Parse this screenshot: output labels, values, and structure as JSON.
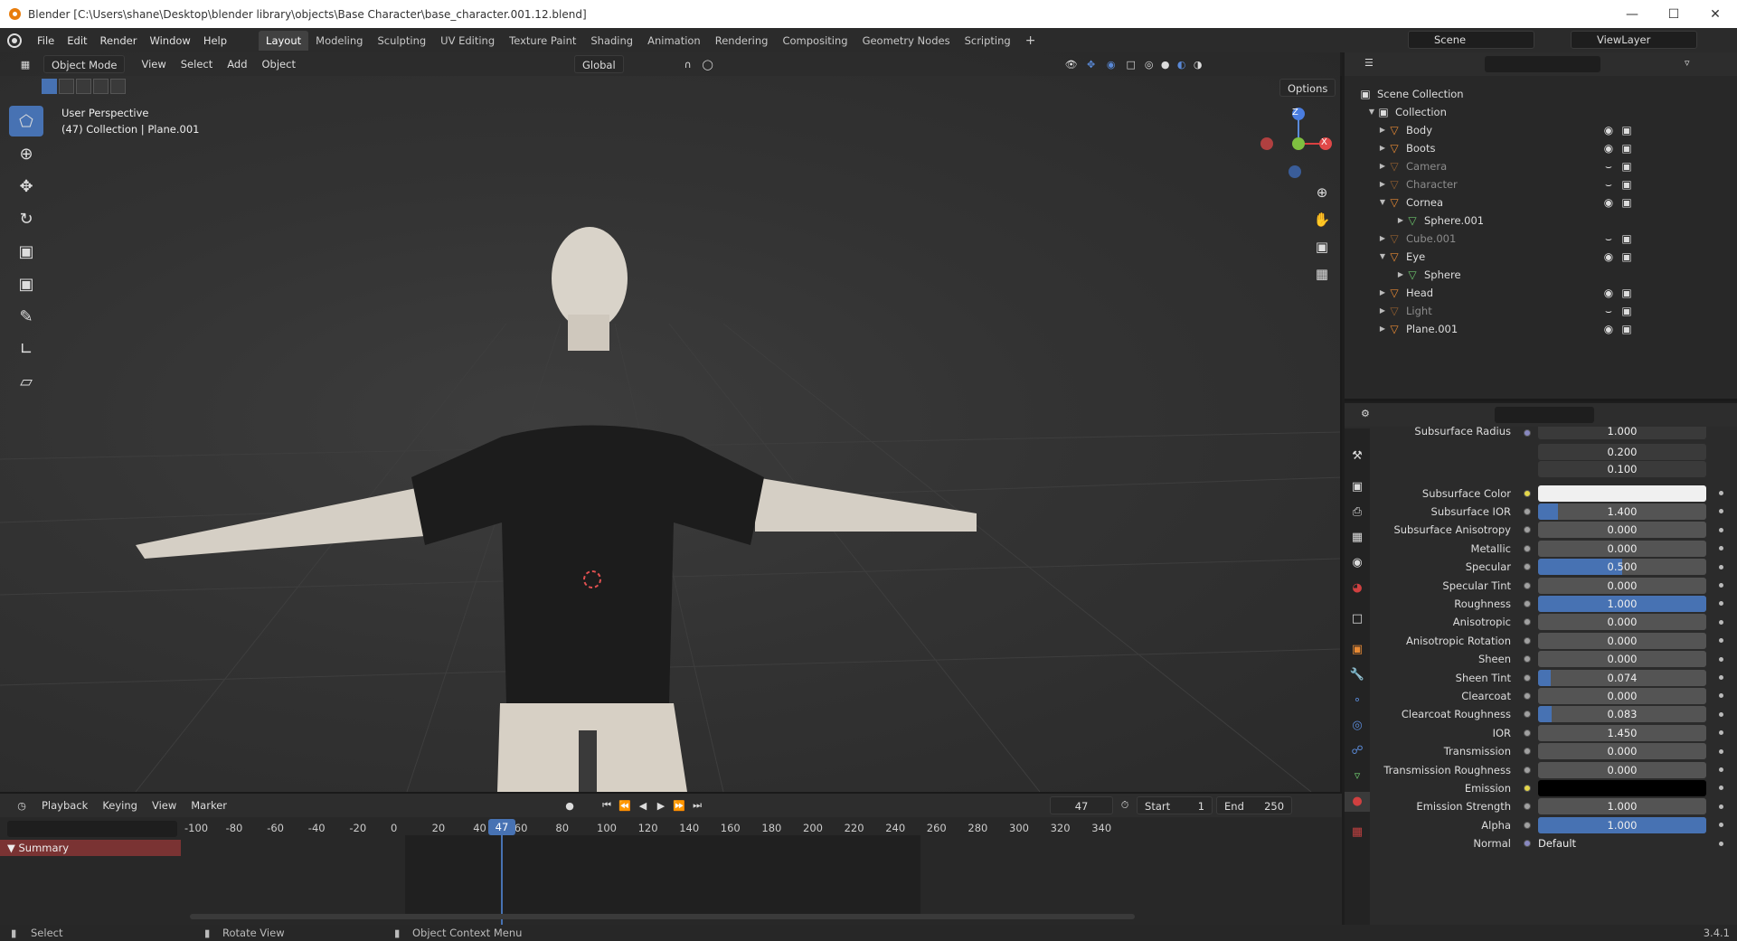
{
  "window": {
    "title": "Blender [C:\\Users\\shane\\Desktop\\blender library\\objects\\Base Character\\base_character.001.12.blend]"
  },
  "menu": [
    "File",
    "Edit",
    "Render",
    "Window",
    "Help"
  ],
  "workspaces": [
    "Layout",
    "Modeling",
    "Sculpting",
    "UV Editing",
    "Texture Paint",
    "Shading",
    "Animation",
    "Rendering",
    "Compositing",
    "Geometry Nodes",
    "Scripting"
  ],
  "active_workspace": "Layout",
  "scene": {
    "name": "Scene",
    "view_layer": "ViewLayer"
  },
  "viewport": {
    "mode": "Object Mode",
    "menus": [
      "View",
      "Select",
      "Add",
      "Object"
    ],
    "orientation": "Global",
    "options_label": "Options",
    "overlay_line1": "User Perspective",
    "overlay_line2": "(47) Collection | Plane.001",
    "gizmo": {
      "z": "Z",
      "x": "X"
    }
  },
  "timeline": {
    "menus": [
      "Playback",
      "Keying",
      "View",
      "Marker"
    ],
    "current_frame": "47",
    "start_label": "Start",
    "start": "1",
    "end_label": "End",
    "end": "250",
    "ruler": [
      "-100",
      "-80",
      "-60",
      "-40",
      "-20",
      "0",
      "20",
      "40",
      "60",
      "80",
      "100",
      "120",
      "140",
      "160",
      "180",
      "200",
      "220",
      "240",
      "260",
      "280",
      "300",
      "320",
      "340"
    ],
    "summary": "Summary"
  },
  "outliner": {
    "root": "Scene Collection",
    "collection": "Collection",
    "items": [
      {
        "name": "Body",
        "dim": false,
        "expanded": false,
        "depth": 0
      },
      {
        "name": "Boots",
        "dim": false,
        "expanded": false,
        "depth": 0
      },
      {
        "name": "Camera",
        "dim": true,
        "expanded": false,
        "depth": 0
      },
      {
        "name": "Character",
        "dim": true,
        "expanded": false,
        "depth": 0
      },
      {
        "name": "Cornea",
        "dim": false,
        "expanded": true,
        "depth": 0
      },
      {
        "name": "Sphere.001",
        "dim": false,
        "expanded": false,
        "depth": 1
      },
      {
        "name": "Cube.001",
        "dim": true,
        "expanded": false,
        "depth": 0
      },
      {
        "name": "Eye",
        "dim": false,
        "expanded": true,
        "depth": 0
      },
      {
        "name": "Sphere",
        "dim": false,
        "expanded": false,
        "depth": 1
      },
      {
        "name": "Head",
        "dim": false,
        "expanded": false,
        "depth": 0
      },
      {
        "name": "Light",
        "dim": true,
        "expanded": false,
        "depth": 0
      },
      {
        "name": "Plane.001",
        "dim": false,
        "expanded": false,
        "depth": 0
      }
    ]
  },
  "properties": {
    "subsurface_radius": {
      "label": "Subsurface Radius",
      "values": [
        "1.000",
        "0.200",
        "0.100"
      ]
    },
    "rows": [
      {
        "label": "Subsurface Color",
        "value": "",
        "fill": 1.0,
        "kind": "color_white",
        "socket": "yellow"
      },
      {
        "label": "Subsurface IOR",
        "value": "1.400",
        "fill": 0.12,
        "kind": "slider",
        "socket": "grey"
      },
      {
        "label": "Subsurface Anisotropy",
        "value": "0.000",
        "fill": 0,
        "kind": "slider",
        "socket": "grey"
      },
      {
        "label": "Metallic",
        "value": "0.000",
        "fill": 0,
        "kind": "slider",
        "socket": "grey"
      },
      {
        "label": "Specular",
        "value": "0.500",
        "fill": 0.5,
        "kind": "slider",
        "socket": "grey"
      },
      {
        "label": "Specular Tint",
        "value": "0.000",
        "fill": 0,
        "kind": "slider",
        "socket": "grey"
      },
      {
        "label": "Roughness",
        "value": "1.000",
        "fill": 1.0,
        "kind": "slider",
        "socket": "grey"
      },
      {
        "label": "Anisotropic",
        "value": "0.000",
        "fill": 0,
        "kind": "slider",
        "socket": "grey"
      },
      {
        "label": "Anisotropic Rotation",
        "value": "0.000",
        "fill": 0,
        "kind": "slider",
        "socket": "grey"
      },
      {
        "label": "Sheen",
        "value": "0.000",
        "fill": 0,
        "kind": "slider",
        "socket": "grey"
      },
      {
        "label": "Sheen Tint",
        "value": "0.074",
        "fill": 0.074,
        "kind": "slider",
        "socket": "grey"
      },
      {
        "label": "Clearcoat",
        "value": "0.000",
        "fill": 0,
        "kind": "slider",
        "socket": "grey"
      },
      {
        "label": "Clearcoat Roughness",
        "value": "0.083",
        "fill": 0.083,
        "kind": "slider",
        "socket": "grey"
      },
      {
        "label": "IOR",
        "value": "1.450",
        "fill": 0,
        "kind": "slider",
        "socket": "grey"
      },
      {
        "label": "Transmission",
        "value": "0.000",
        "fill": 0,
        "kind": "slider",
        "socket": "grey"
      },
      {
        "label": "Transmission Roughness",
        "value": "0.000",
        "fill": 0,
        "kind": "slider",
        "socket": "grey"
      },
      {
        "label": "Emission",
        "value": "",
        "fill": 1.0,
        "kind": "color_black",
        "socket": "yellow"
      },
      {
        "label": "Emission Strength",
        "value": "1.000",
        "fill": 0,
        "kind": "slider",
        "socket": "grey"
      },
      {
        "label": "Alpha",
        "value": "1.000",
        "fill": 1.0,
        "kind": "slider",
        "socket": "grey"
      },
      {
        "label": "Normal",
        "value": "Default",
        "fill": 0,
        "kind": "text",
        "socket": "blue"
      }
    ]
  },
  "status": {
    "select": "Select",
    "rotate": "Rotate View",
    "context": "Object Context Menu",
    "version": "3.4.1"
  },
  "colors": {
    "accent": "#4772b3",
    "object_orange": "#e88a34",
    "mesh_green": "#6cc46c"
  }
}
